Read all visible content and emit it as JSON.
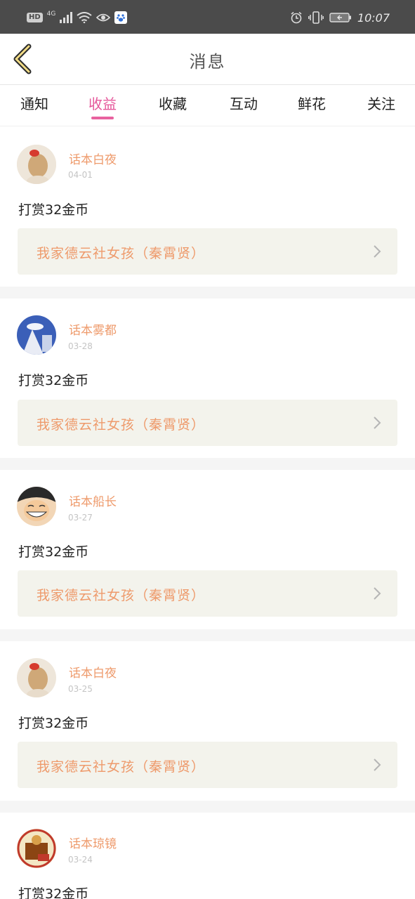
{
  "status_bar": {
    "hd": "HD",
    "network": "4G",
    "time": "10:07",
    "icons": [
      "signal-icon",
      "wifi-icon",
      "eye-icon",
      "baidu-paw-icon",
      "alarm-icon",
      "vibrate-icon",
      "battery-icon"
    ]
  },
  "header": {
    "title": "消息",
    "back_icon": "chevron-left-icon"
  },
  "tabs": [
    {
      "label": "通知",
      "active": false
    },
    {
      "label": "收益",
      "active": true
    },
    {
      "label": "收藏",
      "active": false
    },
    {
      "label": "互动",
      "active": false
    },
    {
      "label": "鲜花",
      "active": false
    },
    {
      "label": "关注",
      "active": false
    }
  ],
  "messages": [
    {
      "user": "话本白夜",
      "date": "04-01",
      "text": "打赏32金币",
      "link": "我家德云社女孩（秦霄贤）"
    },
    {
      "user": "话本雾都",
      "date": "03-28",
      "text": "打赏32金币",
      "link": "我家德云社女孩（秦霄贤）"
    },
    {
      "user": "话本船长",
      "date": "03-27",
      "text": "打赏32金币",
      "link": "我家德云社女孩（秦霄贤）"
    },
    {
      "user": "话本白夜",
      "date": "03-25",
      "text": "打赏32金币",
      "link": "我家德云社女孩（秦霄贤）"
    },
    {
      "user": "话本琼镜",
      "date": "03-24",
      "text": "打赏32金币",
      "link": ""
    }
  ],
  "colors": {
    "accent": "#e5579a",
    "username": "#ee9a6b",
    "link_bg": "#f3f3ec",
    "status_bar": "#4b4b4b"
  }
}
